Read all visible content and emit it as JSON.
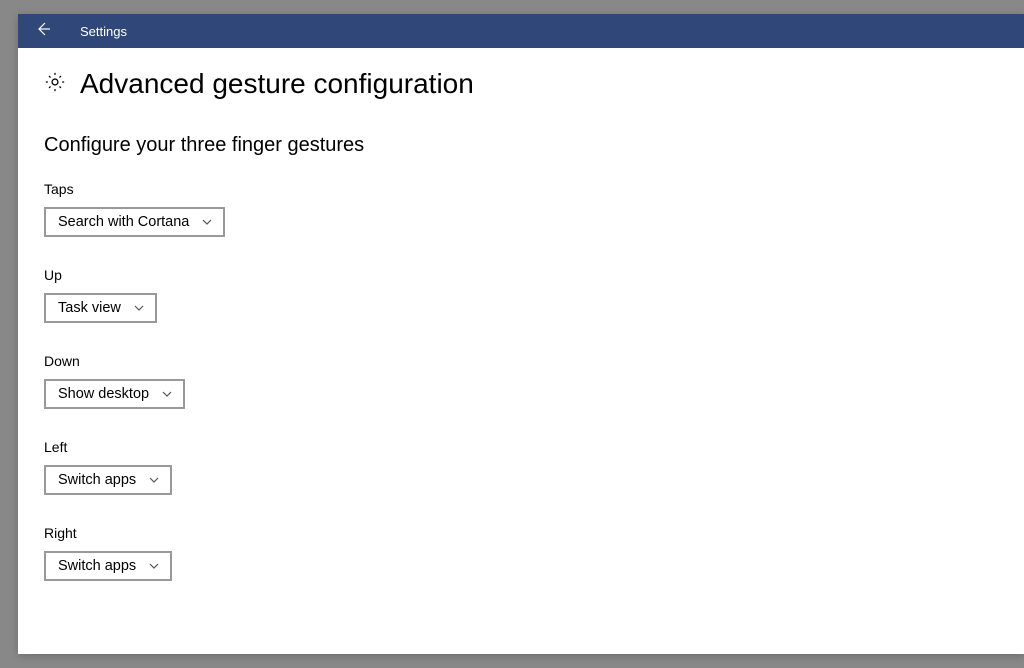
{
  "titlebar": {
    "app_label": "Settings"
  },
  "page": {
    "title": "Advanced gesture configuration",
    "section_title": "Configure your three finger gestures"
  },
  "fields": {
    "taps": {
      "label": "Taps",
      "value": "Search with Cortana"
    },
    "up": {
      "label": "Up",
      "value": "Task view"
    },
    "down": {
      "label": "Down",
      "value": "Show desktop"
    },
    "left": {
      "label": "Left",
      "value": "Switch apps"
    },
    "right": {
      "label": "Right",
      "value": "Switch apps"
    }
  }
}
